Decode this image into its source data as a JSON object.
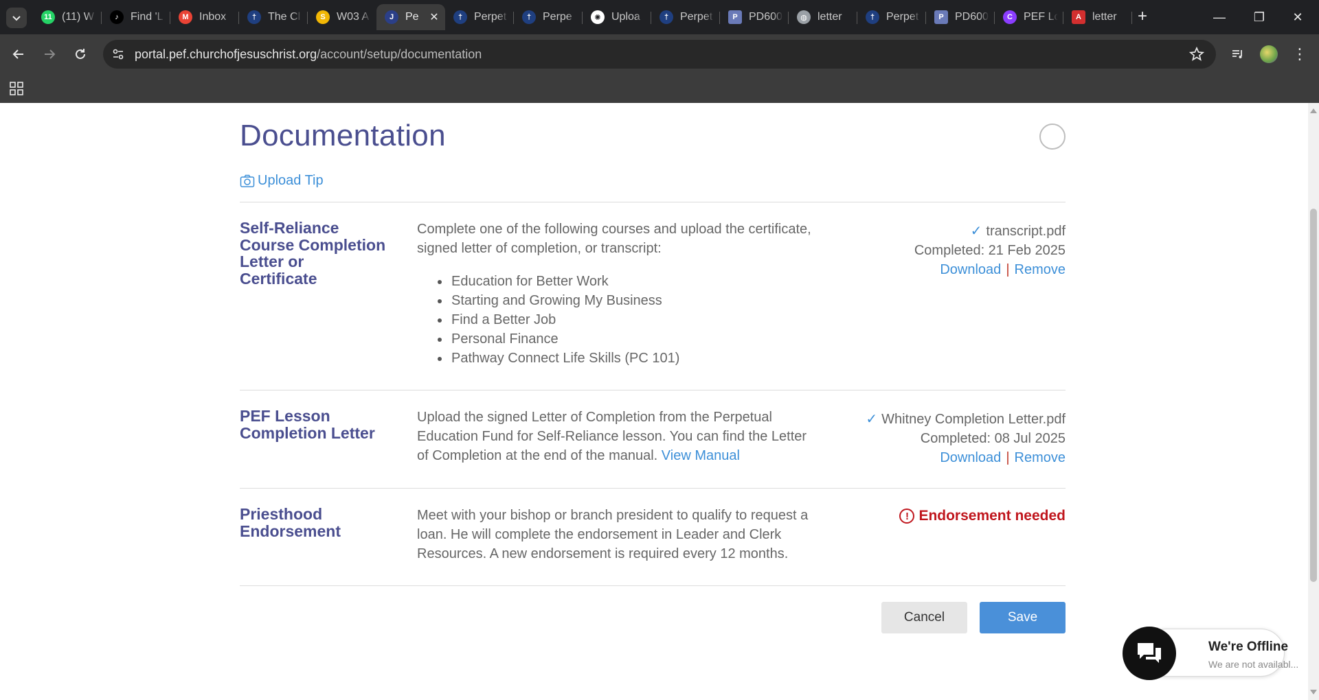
{
  "browser": {
    "tabs": [
      {
        "title": "(11) W",
        "icon": "whatsapp-icon",
        "color": "#25d366",
        "glyph": "11"
      },
      {
        "title": "Find 'L",
        "icon": "tiktok-icon",
        "color": "#000000",
        "glyph": "♪"
      },
      {
        "title": "Inbox",
        "icon": "gmail-icon",
        "color": "#ea4335",
        "glyph": "M"
      },
      {
        "title": "The Cl",
        "icon": "church-icon",
        "color": "#1f3f80",
        "glyph": "†"
      },
      {
        "title": "W03 A",
        "icon": "byu-pathway-icon",
        "color": "#f2b705",
        "glyph": "S"
      },
      {
        "title": "Pe",
        "icon": "pef-icon",
        "color": "#2b3f88",
        "glyph": "J",
        "active": true
      },
      {
        "title": "Perpet",
        "icon": "church-icon",
        "color": "#1f3f80",
        "glyph": "†"
      },
      {
        "title": "Perpe",
        "icon": "church-icon",
        "color": "#1f3f80",
        "glyph": "†"
      },
      {
        "title": "Uploa",
        "icon": "chatgpt-icon",
        "color": "#ffffff",
        "glyph": "✺"
      },
      {
        "title": "Perpet",
        "icon": "church-icon",
        "color": "#1f3f80",
        "glyph": "†"
      },
      {
        "title": "PD600",
        "icon": "document-icon",
        "color": "#6a7ab8",
        "glyph": "P"
      },
      {
        "title": "letter",
        "icon": "globe-icon",
        "color": "#9aa0a6",
        "glyph": "◍"
      },
      {
        "title": "Perpet",
        "icon": "church-icon",
        "color": "#1f3f80",
        "glyph": "†"
      },
      {
        "title": "PD600",
        "icon": "document-icon",
        "color": "#6a7ab8",
        "glyph": "P"
      },
      {
        "title": "PEF Lo",
        "icon": "canva-icon",
        "color": "#8b3dff",
        "glyph": "C"
      },
      {
        "title": "letter",
        "icon": "pdf-icon",
        "color": "#d32f2f",
        "glyph": "A"
      }
    ],
    "close_glyph": "✕",
    "new_tab_glyph": "+",
    "url_domain": "portal.pef.churchofjesuschrist.org",
    "url_path": "/account/setup/documentation",
    "minimize": "—",
    "restore": "❐",
    "close": "✕",
    "menu": "⋮"
  },
  "page": {
    "title": "Documentation",
    "upload_tip": "Upload Tip",
    "requirements": [
      {
        "title": [
          "Self-Reliance",
          "Course Completion",
          "Letter or",
          "Certificate"
        ],
        "description": "Complete one of the following courses and upload the certificate, signed letter of completion, or transcript:",
        "courses": [
          "Education for Better Work",
          "Starting and Growing My Business",
          "Find a Better Job",
          "Personal Finance",
          "Pathway Connect Life Skills (PC 101)"
        ],
        "file": "transcript.pdf",
        "completed": "Completed: 21 Feb 2025",
        "download": "Download",
        "separator": "|",
        "remove": "Remove"
      },
      {
        "title": [
          "PEF Lesson",
          "Completion Letter"
        ],
        "description": "Upload the signed Letter of Completion from the Perpetual Education Fund for Self-Reliance lesson. You can find the Letter of Completion at the end of the manual.",
        "link": "View Manual",
        "file": "Whitney Completion Letter.pdf",
        "completed": "Completed: 08 Jul 2025",
        "download": "Download",
        "separator": "|",
        "remove": "Remove"
      },
      {
        "title": [
          "Priesthood",
          "Endorsement"
        ],
        "description": "Meet with your bishop or branch president to qualify to request a loan. He will complete the endorsement in Leader and Clerk Resources. A new endorsement is required every 12 months.",
        "status": "Endorsement needed",
        "status_icon": "!"
      }
    ],
    "check_glyph": "✓",
    "cancel": "Cancel",
    "save": "Save"
  },
  "chat": {
    "title": "We're Offline",
    "subtitle": "We are not availabl..."
  },
  "colors": {
    "heading": "#4a4e8f",
    "link": "#3c8fd8",
    "error": "#c0161d",
    "save_button": "#4a90d9"
  }
}
